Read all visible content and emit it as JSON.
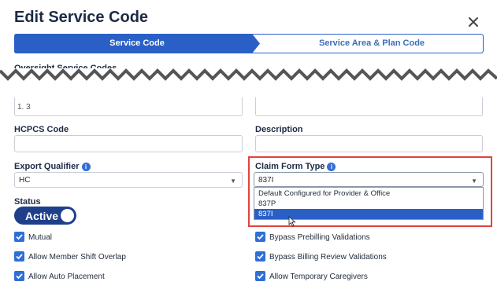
{
  "dialog": {
    "title": "Edit Service Code",
    "close_icon": "close-icon"
  },
  "steps": [
    {
      "label": "Service Code",
      "active": true
    },
    {
      "label": "Service Area & Plan Code",
      "active": false
    }
  ],
  "clipped_section_label": "Oversight Service Codes",
  "fields": {
    "partial_value": "1. 3",
    "hcpcs_label": "HCPCS Code",
    "hcpcs_value": "",
    "description_label": "Description",
    "description_value": "",
    "export_qualifier_label": "Export Qualifier",
    "export_qualifier_value": "HC",
    "claim_form_label": "Claim Form Type",
    "claim_form_value": "837I",
    "claim_form_options": [
      "Default Configured for Provider & Office",
      "837P",
      "837I"
    ],
    "claim_form_selected_index": 2,
    "status_label": "Status",
    "status_value": "Active"
  },
  "checkboxes": {
    "left": [
      {
        "label": "Mutual",
        "checked": true
      },
      {
        "label": "Allow Member Shift Overlap",
        "checked": true
      },
      {
        "label": "Allow Auto Placement",
        "checked": true
      }
    ],
    "right": [
      {
        "label": "Bypass Prebilling Validations",
        "checked": true
      },
      {
        "label": "Bypass Billing Review Validations",
        "checked": true
      },
      {
        "label": "Allow Temporary Caregivers",
        "checked": true
      }
    ]
  },
  "colors": {
    "accent": "#2a60c6",
    "step_active": "#2a60c6",
    "highlight": "#e0443d"
  }
}
